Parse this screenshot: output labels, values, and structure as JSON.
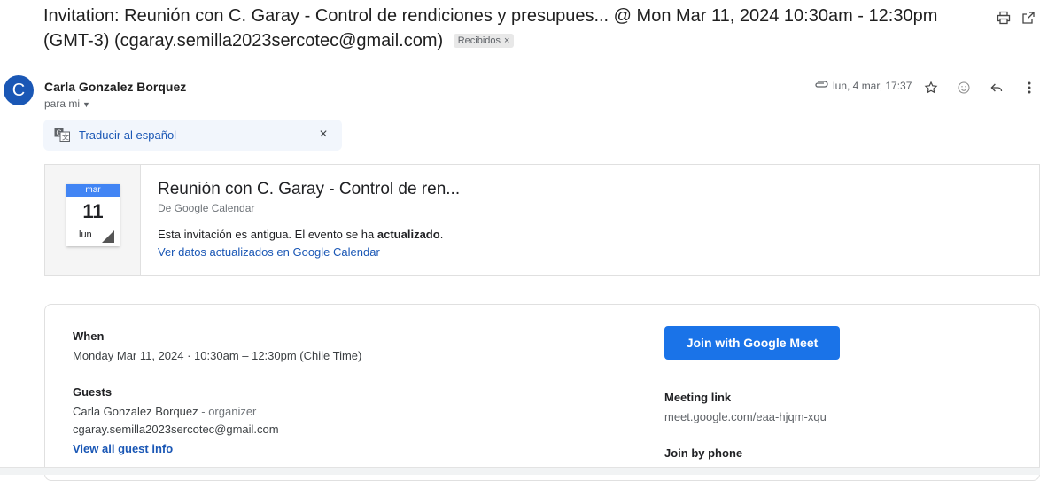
{
  "email": {
    "subject": "Invitation: Reunión con C. Garay - Control de rendiciones y presupues... @ Mon Mar 11, 2024 10:30am - 12:30pm (GMT-3) (cgaray.semilla2023sercotec@gmail.com)",
    "label_chip": "Recibidos",
    "label_chip_close": "×",
    "sender": {
      "avatar_letter": "C",
      "name": "Carla Gonzalez Borquez",
      "to_me": "para mi",
      "date": "lun, 4 mar, 17:37"
    }
  },
  "translate": {
    "label": "Traducir al español",
    "close": "×"
  },
  "calendar_card": {
    "month": "mar",
    "day": "11",
    "weekday": "lun",
    "title": "Reunión con C. Garay - Control de ren...",
    "from": "De Google Calendar",
    "notice_prefix": "Esta invitación es antigua. El evento se ha ",
    "notice_bold": "actualizado",
    "notice_suffix": ".",
    "link": "Ver datos actualizados en Google Calendar"
  },
  "details": {
    "when_label": "When",
    "when_value": "Monday Mar 11, 2024 · 10:30am – 12:30pm (Chile Time)",
    "guests_label": "Guests",
    "organizer_name": "Carla Gonzalez Borquez",
    "organizer_suffix": " - organizer",
    "guest_email": "cgaray.semilla2023sercotec@gmail.com",
    "view_guests": "View all guest info",
    "join_button": "Join with Google Meet",
    "meeting_link_label": "Meeting link",
    "meeting_link": "meet.google.com/eaa-hjqm-xqu",
    "join_phone_label": "Join by phone"
  },
  "icons": [
    "print-icon",
    "open-new-window-icon",
    "attachment-icon",
    "star-icon",
    "emoji-icon",
    "reply-icon",
    "more-vert-icon",
    "translate-icon",
    "close-icon"
  ],
  "colors": {
    "accent": "#1a73e8",
    "link": "#1a57b5",
    "avatar": "#1a57b5",
    "calendar_month": "#4285f4"
  }
}
